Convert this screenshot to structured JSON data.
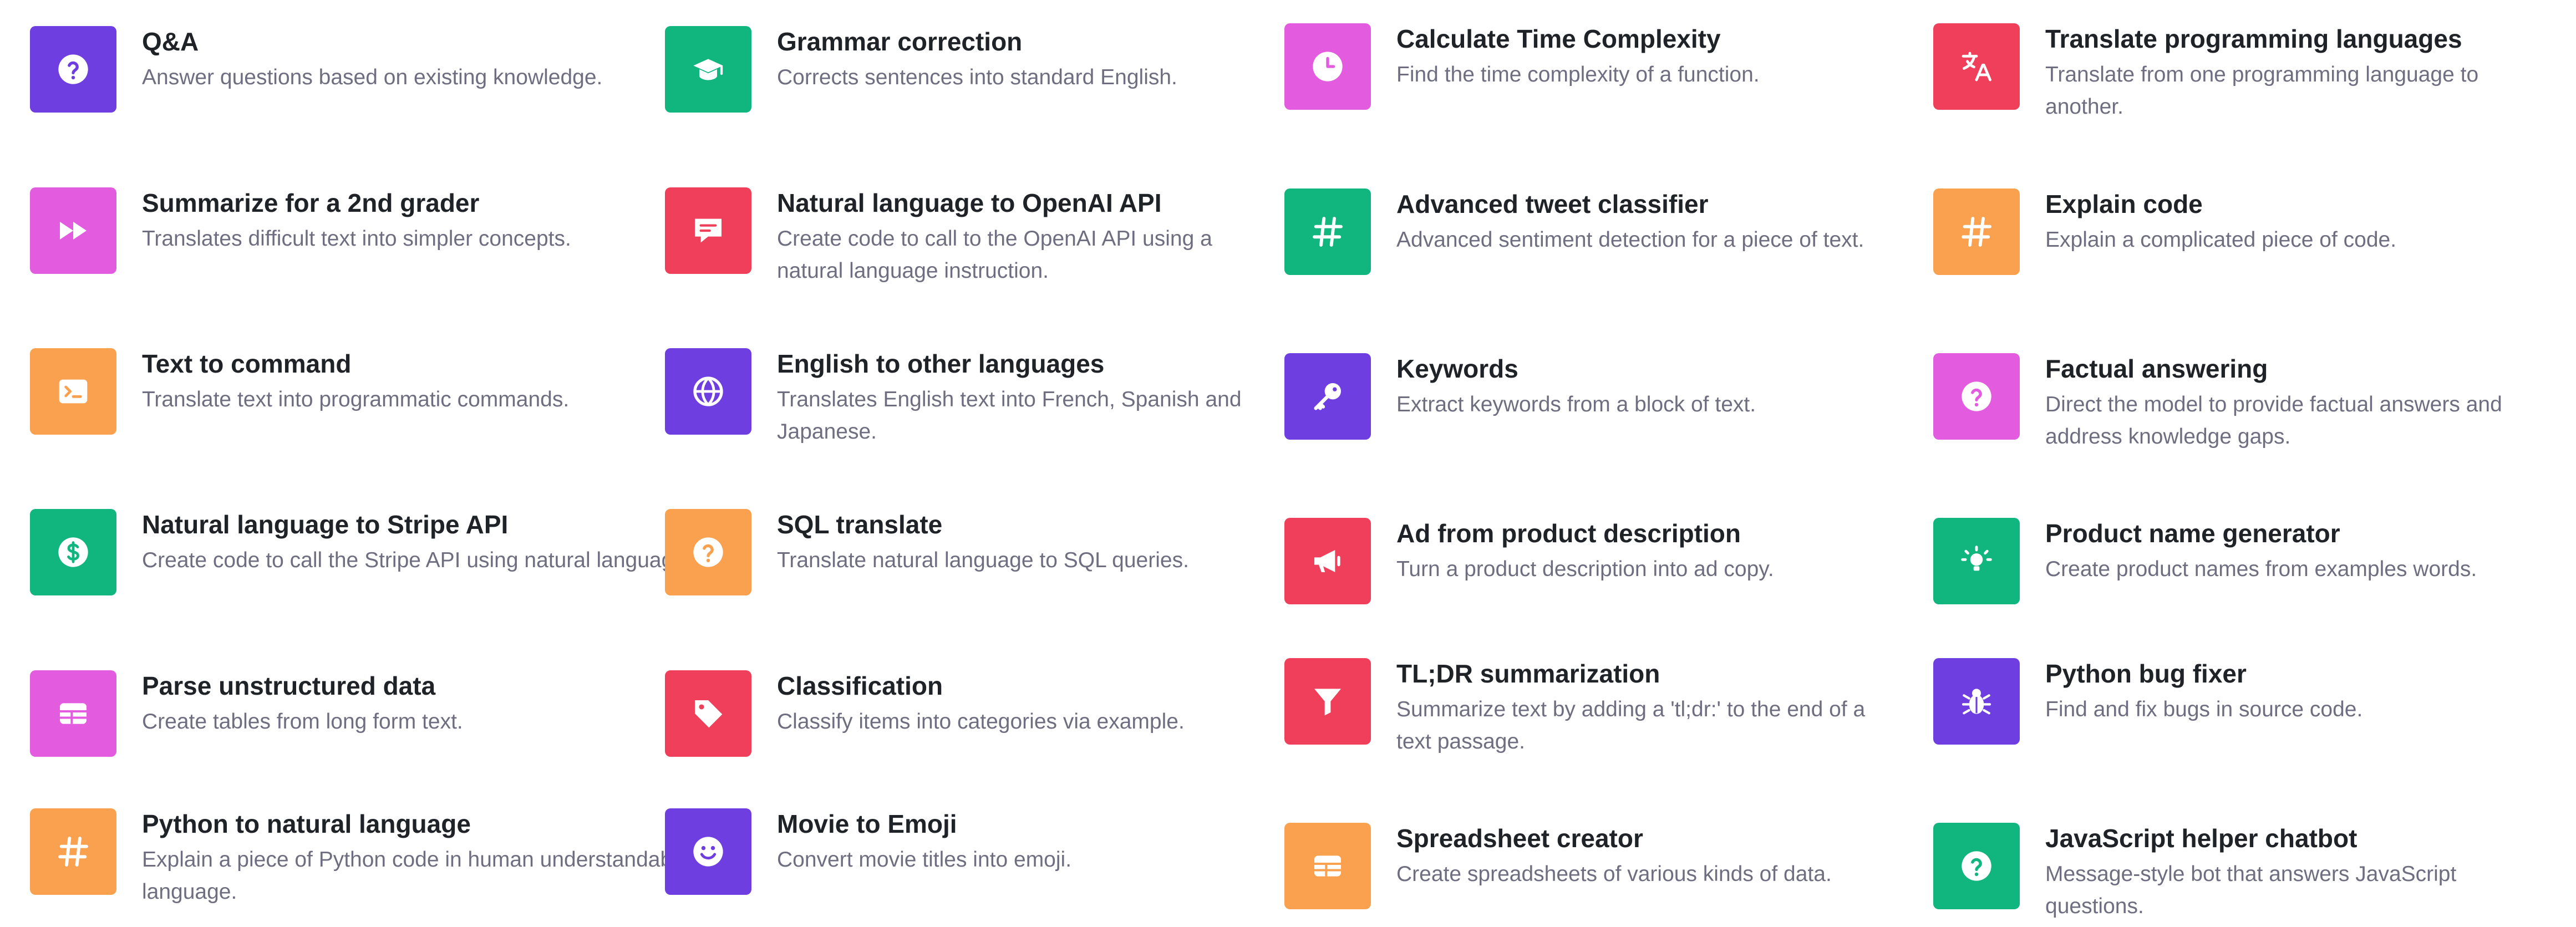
{
  "colors": {
    "purple": "#6e3ee0",
    "green": "#11b67e",
    "pink": "#e35bdf",
    "red": "#f03f5a",
    "orange": "#f9a14f"
  },
  "examples": [
    {
      "title": "Q&A",
      "description": "Answer questions based on existing knowledge.",
      "icon": "question-icon",
      "color": "purple"
    },
    {
      "title": "Grammar correction",
      "description": "Corrects sentences into standard English.",
      "icon": "graduation-cap-icon",
      "color": "green"
    },
    {
      "title": "Calculate Time Complexity",
      "description": "Find the time complexity of a function.",
      "icon": "clock-icon",
      "color": "pink"
    },
    {
      "title": "Translate programming languages",
      "description": "Translate from one programming language to another.",
      "icon": "translate-icon",
      "color": "red"
    },
    {
      "title": "Summarize for a 2nd grader",
      "description": "Translates difficult text into simpler concepts.",
      "icon": "fast-forward-icon",
      "color": "pink"
    },
    {
      "title": "Natural language to OpenAI API",
      "description": "Create code to call to the OpenAI API using a natural language instruction.",
      "icon": "message-icon",
      "color": "red"
    },
    {
      "title": "Advanced tweet classifier",
      "description": "Advanced sentiment detection for a piece of text.",
      "icon": "hashtag-icon",
      "color": "green"
    },
    {
      "title": "Explain code",
      "description": "Explain a complicated piece of code.",
      "icon": "hashtag-icon",
      "color": "orange"
    },
    {
      "title": "Text to command",
      "description": "Translate text into programmatic commands.",
      "icon": "terminal-icon",
      "color": "orange"
    },
    {
      "title": "English to other languages",
      "description": "Translates English text into French, Spanish and Japanese.",
      "icon": "globe-icon",
      "color": "purple"
    },
    {
      "title": "Keywords",
      "description": "Extract keywords from a block of text.",
      "icon": "key-icon",
      "color": "purple"
    },
    {
      "title": "Factual answering",
      "description": "Direct the model to provide factual answers and address knowledge gaps.",
      "icon": "question-icon",
      "color": "pink"
    },
    {
      "title": "Natural language to Stripe API",
      "description": "Create code to call the Stripe API using natural language.",
      "icon": "dollar-icon",
      "color": "green"
    },
    {
      "title": "SQL translate",
      "description": "Translate natural language to SQL queries.",
      "icon": "question-icon",
      "color": "orange"
    },
    {
      "title": "Ad from product description",
      "description": "Turn a product description into ad copy.",
      "icon": "megaphone-icon",
      "color": "red"
    },
    {
      "title": "Product name generator",
      "description": "Create product names from examples words.",
      "icon": "lightbulb-icon",
      "color": "green"
    },
    {
      "title": "Parse unstructured data",
      "description": "Create tables from long form text.",
      "icon": "table-icon",
      "color": "pink"
    },
    {
      "title": "Classification",
      "description": "Classify items into categories via example.",
      "icon": "tag-icon",
      "color": "red"
    },
    {
      "title": "TL;DR summarization",
      "description": "Summarize text by adding a 'tl;dr:' to the end of a text passage.",
      "icon": "filter-icon",
      "color": "red"
    },
    {
      "title": "Python bug fixer",
      "description": "Find and fix bugs in source code.",
      "icon": "bug-icon",
      "color": "purple"
    },
    {
      "title": "Python to natural language",
      "description": "Explain a piece of Python code in human understandable language.",
      "icon": "hashtag-icon",
      "color": "orange"
    },
    {
      "title": "Movie to Emoji",
      "description": "Convert movie titles into emoji.",
      "icon": "smile-icon",
      "color": "purple"
    },
    {
      "title": "Spreadsheet creator",
      "description": "Create spreadsheets of various kinds of data.",
      "icon": "table-icon",
      "color": "orange"
    },
    {
      "title": "JavaScript helper chatbot",
      "description": "Message-style bot that answers JavaScript questions.",
      "icon": "question-icon",
      "color": "green"
    }
  ]
}
